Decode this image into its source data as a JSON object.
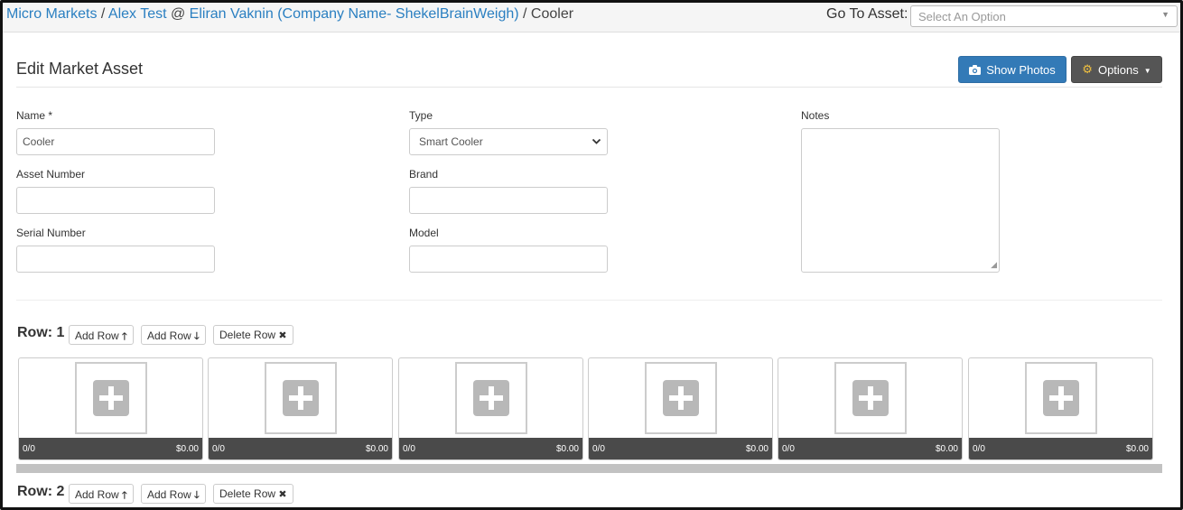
{
  "breadcrumb": {
    "micro_markets": "Micro Markets",
    "sep1": " / ",
    "alex_test": "Alex Test",
    "at": " @ ",
    "company": "Eliran Vaknin (Company Name- ShekelBrainWeigh)",
    "sep2": " / ",
    "current": "Cooler"
  },
  "goto": {
    "label": "Go To Asset:",
    "placeholder": "Select An Option"
  },
  "page": {
    "title": "Edit Market Asset"
  },
  "buttons": {
    "show_photos": "Show Photos",
    "options": "Options"
  },
  "form": {
    "name_label": "Name *",
    "name_value": "Cooler",
    "type_label": "Type",
    "type_value": "Smart Cooler",
    "notes_label": "Notes",
    "asset_number_label": "Asset Number",
    "asset_number_value": "",
    "brand_label": "Brand",
    "brand_value": "",
    "serial_number_label": "Serial Number",
    "serial_number_value": "",
    "model_label": "Model",
    "model_value": ""
  },
  "rows": [
    {
      "label": "Row: 1",
      "add_row_up": "Add Row",
      "add_row_down": "Add Row",
      "delete_row": "Delete Row",
      "slots": [
        {
          "count": "0/0",
          "price": "$0.00"
        },
        {
          "count": "0/0",
          "price": "$0.00"
        },
        {
          "count": "0/0",
          "price": "$0.00"
        },
        {
          "count": "0/0",
          "price": "$0.00"
        },
        {
          "count": "0/0",
          "price": "$0.00"
        },
        {
          "count": "0/0",
          "price": "$0.00"
        }
      ]
    },
    {
      "label": "Row: 2",
      "add_row_up": "Add Row",
      "add_row_down": "Add Row",
      "delete_row": "Delete Row"
    }
  ],
  "icons": {
    "up": "arrow-up-icon",
    "down": "arrow-down-icon",
    "delete": "times-icon",
    "camera": "camera-icon",
    "gears": "gears-icon"
  },
  "colors": {
    "primary": "#337ab7",
    "link": "#2a7fc1",
    "dark_button": "#555555"
  }
}
